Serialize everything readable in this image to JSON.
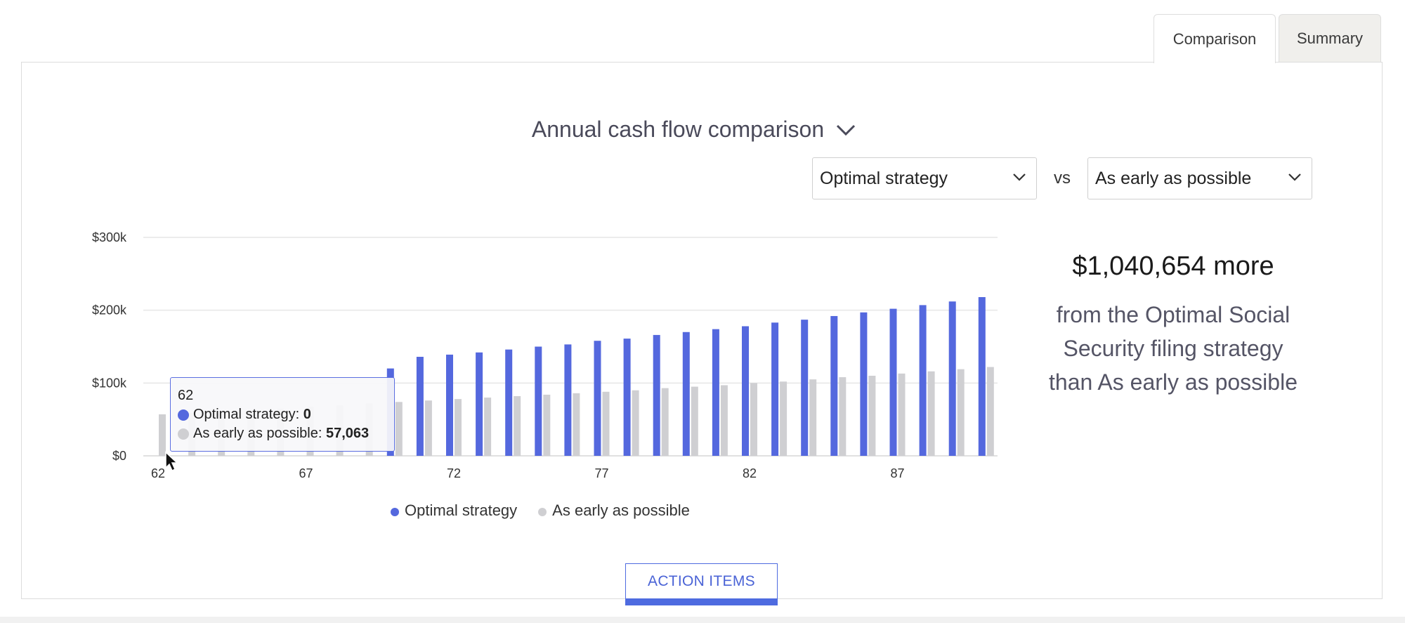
{
  "tabs": [
    {
      "label": "Comparison",
      "active": true
    },
    {
      "label": "Summary",
      "active": false
    }
  ],
  "header": {
    "title": "Annual cash flow comparison"
  },
  "selectors": {
    "left": "Optimal strategy",
    "vs": "vs",
    "right": "As early as possible"
  },
  "summary": {
    "amount": "$1,040,654 more",
    "line1": "from the Optimal Social",
    "line2": "Security filing strategy",
    "line3": "than As early as possible"
  },
  "tooltip": {
    "title": "62",
    "optimal_label": "Optimal strategy: ",
    "optimal_value": "0",
    "early_label": "As early as possible: ",
    "early_value": "57,063"
  },
  "action": {
    "label": "ACTION ITEMS"
  },
  "colors": {
    "optimal": "#5468de",
    "early": "#cfcfd2",
    "grid": "#e6e6e6",
    "accent": "#4e6be0"
  },
  "chart_data": {
    "type": "bar",
    "xlabel": "",
    "ylabel": "",
    "ylim": [
      0,
      300000
    ],
    "yticks": [
      0,
      100000,
      200000,
      300000
    ],
    "ytick_labels": [
      "$0",
      "$100k",
      "$200k",
      "$300k"
    ],
    "categories": [
      62,
      63,
      64,
      65,
      66,
      67,
      68,
      69,
      70,
      71,
      72,
      73,
      74,
      75,
      76,
      77,
      78,
      79,
      80,
      81,
      82,
      83,
      84,
      85,
      86,
      87,
      88,
      89,
      90
    ],
    "xtick_labels": [
      "62",
      "67",
      "72",
      "77",
      "82",
      "87"
    ],
    "series": [
      {
        "name": "Optimal strategy",
        "color": "#5468de",
        "values": [
          0,
          0,
          0,
          0,
          0,
          0,
          0,
          0,
          120000,
          136000,
          139000,
          142000,
          146000,
          150000,
          153000,
          158000,
          161000,
          166000,
          170000,
          174000,
          178000,
          183000,
          187000,
          192000,
          197000,
          202000,
          207000,
          212000,
          218000
        ]
      },
      {
        "name": "As early as possible",
        "color": "#cfcfd2",
        "values": [
          57063,
          59000,
          61000,
          63000,
          65000,
          67000,
          69000,
          72000,
          74000,
          76000,
          78000,
          80000,
          82000,
          84000,
          86000,
          88000,
          90000,
          93000,
          95000,
          97000,
          100000,
          102000,
          105000,
          108000,
          110000,
          113000,
          116000,
          119000,
          122000
        ]
      }
    ],
    "legend": "bottom-center",
    "grid": true
  }
}
